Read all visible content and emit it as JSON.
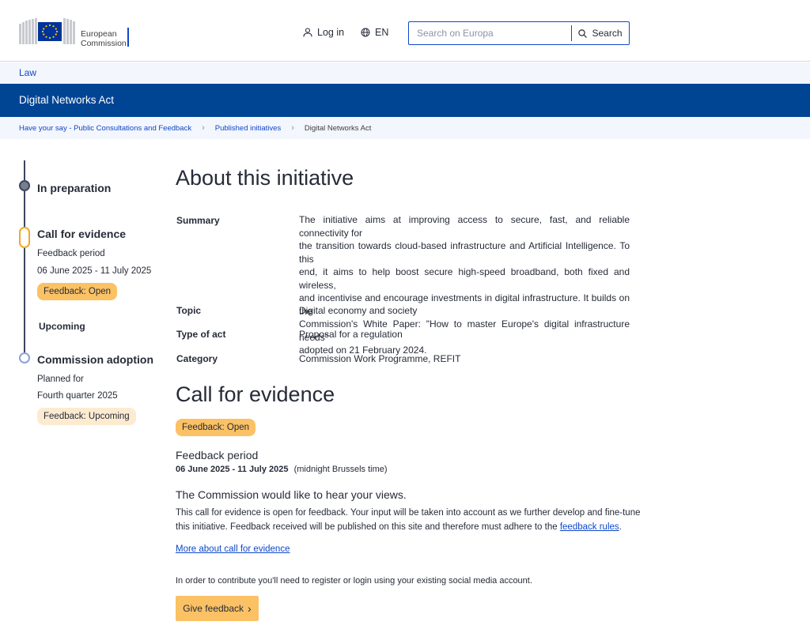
{
  "header": {
    "logo_line1": "European",
    "logo_line2": "Commission",
    "login_label": "Log in",
    "language_label": "EN",
    "search_placeholder": "Search on Europa",
    "search_button_label": "Search"
  },
  "site": {
    "law_link": "Law",
    "page_title": "Digital Networks Act"
  },
  "breadcrumb": {
    "items": [
      "Have your say - Public Consultations and Feedback",
      "Published initiatives"
    ],
    "current": "Digital Networks Act"
  },
  "timeline": {
    "stage1": "In preparation",
    "stage2": {
      "title": "Call for evidence",
      "period_label": "Feedback period",
      "dates": "06 June 2025 - 11 July 2025",
      "badge": "Feedback: Open"
    },
    "upcoming_label": "Upcoming",
    "stage3": {
      "title": "Commission adoption",
      "planned_label": "Planned for",
      "planned_value": "Fourth quarter 2025",
      "badge": "Feedback: Upcoming"
    }
  },
  "about": {
    "heading": "About this initiative",
    "summary_label": "Summary",
    "summary_lines": [
      "The initiative aims at improving access to secure, fast, and reliable connectivity for",
      "the transition towards cloud-based infrastructure and Artificial Intelligence. To this",
      "end, it aims to help boost secure high-speed broadband, both fixed and wireless,",
      "and incentivise and encourage investments in digital infrastructure. It builds on the",
      "Commission's White Paper: \"How to master Europe's digital infrastructure needs\"",
      "adopted on 21 February 2024."
    ],
    "topic_label": "Topic",
    "topic_value": "Digital economy and society",
    "type_label": "Type of act",
    "type_value": "Proposal for a regulation",
    "category_label": "Category",
    "category_value": "Commission Work Programme, REFIT"
  },
  "call": {
    "heading": "Call for evidence",
    "badge": "Feedback: Open",
    "period_heading": "Feedback period",
    "period_dates": "06 June 2025 - 11 July 2025",
    "period_note": "(midnight Brussels time)",
    "hear_heading": "The Commission would like to hear your views.",
    "body_line1": "This call for evidence is open for feedback. Your input will be taken into account as we further develop and fine-tune",
    "body_line2": "this initiative. Feedback received will be published on this site and therefore must adhere to the",
    "feedback_rules_link": "feedback rules",
    "body_line2_end": ".",
    "more_link": "More about call for evidence",
    "register_text": "In order to contribute you'll need to register or login using your existing social media account.",
    "give_feedback_label": "Give feedback"
  },
  "colors": {
    "primary_blue": "#004494",
    "link_blue": "#0e47cb",
    "badge_open": "#fbc165",
    "badge_upcoming": "#fdebd1"
  }
}
